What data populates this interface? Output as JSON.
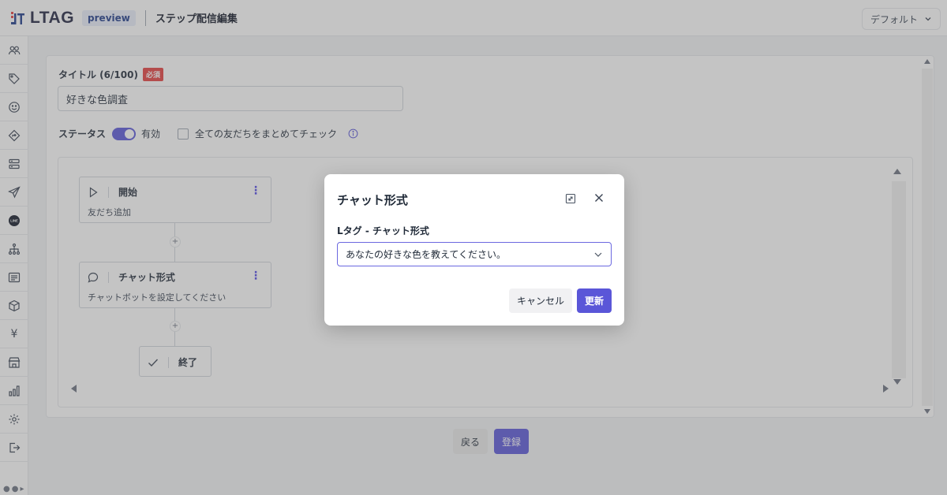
{
  "header": {
    "logo_text": "LTAG",
    "badge": "preview",
    "page_title": "ステップ配信編集",
    "workspace": "デフォルト"
  },
  "sidebar": {
    "items": [
      {
        "icon": "users-icon"
      },
      {
        "icon": "tag-icon"
      },
      {
        "icon": "smile-icon"
      },
      {
        "icon": "diamond-arrow-icon"
      },
      {
        "icon": "server-icon"
      },
      {
        "icon": "send-icon"
      },
      {
        "icon": "line-icon",
        "text": "LINE"
      },
      {
        "icon": "hierarchy-icon"
      },
      {
        "icon": "form-icon"
      },
      {
        "icon": "box-icon"
      },
      {
        "icon": "yen-icon",
        "text": "¥"
      },
      {
        "icon": "store-icon"
      },
      {
        "icon": "chart-icon"
      },
      {
        "icon": "settings-icon"
      },
      {
        "icon": "logout-icon"
      }
    ]
  },
  "form": {
    "title_label": "タイトル (6/100)",
    "required_badge": "必須",
    "title_value": "好きな色調査",
    "status_label": "ステータス",
    "status_value": "有効",
    "status_enabled": true,
    "bulk_check_label": "全ての友だちをまとめてチェック",
    "bulk_check_checked": false
  },
  "flow": {
    "nodes": [
      {
        "title": "開始",
        "subtitle": "友だち追加",
        "icon": "play-icon"
      },
      {
        "title": "チャット形式",
        "subtitle": "チャットボットを設定してください",
        "icon": "chat-icon"
      },
      {
        "title": "終了",
        "icon": "check-icon"
      }
    ],
    "plus": "+"
  },
  "actions": {
    "back": "戻る",
    "register": "登録"
  },
  "modal": {
    "title": "チャット形式",
    "field_label": "Lタグ - チャット形式",
    "selected": "あなたの好きな色を教えてください。",
    "cancel": "キャンセル",
    "update": "更新"
  },
  "colors": {
    "accent": "#5a56d8",
    "required": "#e53e3e"
  }
}
